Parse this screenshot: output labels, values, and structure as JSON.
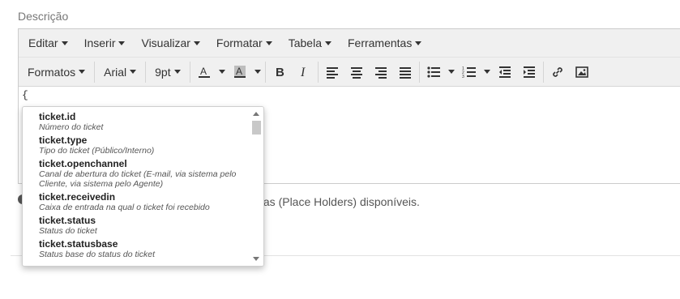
{
  "field": {
    "label": "Descrição"
  },
  "menubar": [
    {
      "label": "Editar"
    },
    {
      "label": "Inserir"
    },
    {
      "label": "Visualizar"
    },
    {
      "label": "Formatar"
    },
    {
      "label": "Tabela"
    },
    {
      "label": "Ferramentas"
    }
  ],
  "toolbar": {
    "formats": "Formatos",
    "font": "Arial",
    "size": "9pt"
  },
  "content": {
    "text": "{"
  },
  "help": {
    "text": "nicas (Place Holders) disponíveis."
  },
  "autocomplete": {
    "items": [
      {
        "title": "ticket.id",
        "desc": "Número do ticket"
      },
      {
        "title": "ticket.type",
        "desc": "Tipo do ticket (Público/Interno)"
      },
      {
        "title": "ticket.openchannel",
        "desc": "Canal de abertura do ticket (E-mail, via sistema pelo Cliente, via sistema pelo Agente)"
      },
      {
        "title": "ticket.receivedin",
        "desc": "Caixa de entrada na qual o ticket foi recebido"
      },
      {
        "title": "ticket.status",
        "desc": "Status do ticket"
      },
      {
        "title": "ticket.statusbase",
        "desc": "Status base do status do ticket"
      }
    ]
  },
  "colors": {
    "menubar_bg": "#f0f0f0",
    "icon": "#333333",
    "border": "#cccccc"
  }
}
